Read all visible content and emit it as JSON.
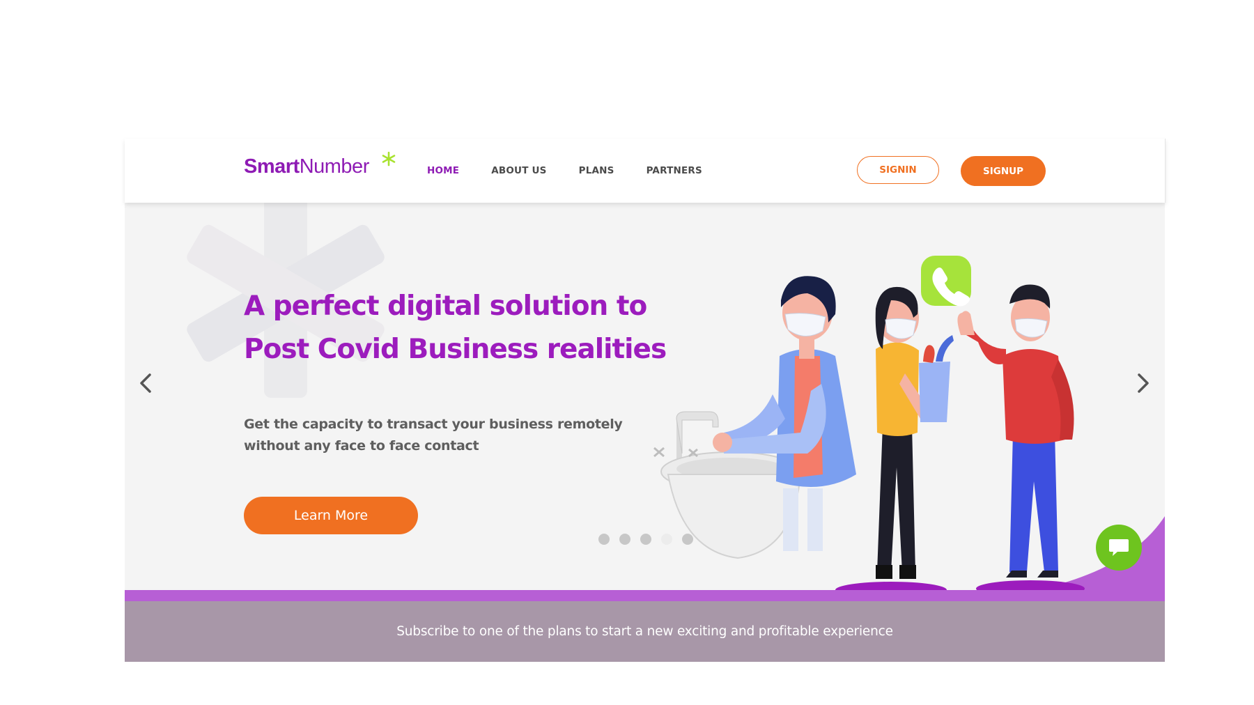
{
  "brand": {
    "name_bold": "Smart",
    "name_light": "Number",
    "accent_color": "#8e1bb4",
    "star_color": "#a8e22f"
  },
  "nav": {
    "items": [
      {
        "label": "HOME",
        "active": true
      },
      {
        "label": "ABOUT US",
        "active": false
      },
      {
        "label": "PLANS",
        "active": false
      },
      {
        "label": "PARTNERS",
        "active": false
      }
    ],
    "signin_label": "SIGNIN",
    "signup_label": "SIGNUP"
  },
  "hero": {
    "headline": "A perfect digital solution to Post Covid Business realities",
    "subtext": "Get the capacity to transact your business remotely without any face to face contact",
    "cta_label": "Learn More",
    "prev_icon": "chevron-left-icon",
    "next_icon": "chevron-right-icon",
    "slides_total": 5,
    "active_slide": 4
  },
  "chat": {
    "icon": "chat-bubble-icon",
    "color": "#6ec41f"
  },
  "banner": {
    "text": "Subscribe to one of the plans to start a new exciting and profitable experience"
  },
  "colors": {
    "primary": "#9c1cbd",
    "orange": "#f07021",
    "band": "#a897a8",
    "hero_bg": "#f4f4f4"
  }
}
